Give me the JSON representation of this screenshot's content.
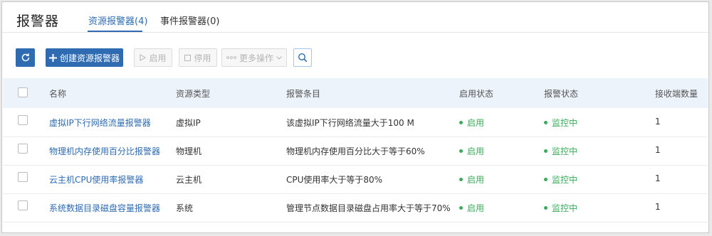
{
  "page": {
    "title": "报警器",
    "tabs": [
      {
        "label": "资源报警器(4)",
        "active": true
      },
      {
        "label": "事件报警器(0)",
        "active": false
      }
    ]
  },
  "toolbar": {
    "refresh_icon": "refresh-icon",
    "create_label": "创建资源报警器",
    "enable_label": "启用",
    "disable_label": "停用",
    "more_label": "更多操作",
    "search_icon": "search-icon"
  },
  "table": {
    "headers": [
      "名称",
      "资源类型",
      "报警条目",
      "启用状态",
      "报警状态",
      "接收端数量"
    ],
    "rows": [
      {
        "name": "虚拟IP下行网络流量报警器",
        "type": "虚拟IP",
        "condition": "该虚拟IP下行网络流量大于100 M",
        "enable": "启用",
        "alarm": "监控中",
        "receivers": "1"
      },
      {
        "name": "物理机内存使用百分比报警器",
        "type": "物理机",
        "condition": "物理机内存使用百分比大于等于60%",
        "enable": "启用",
        "alarm": "监控中",
        "receivers": "1"
      },
      {
        "name": "云主机CPU使用率报警器",
        "type": "云主机",
        "condition": "CPU使用率大于等于80%",
        "enable": "启用",
        "alarm": "监控中",
        "receivers": "1"
      },
      {
        "name": "系统数据目录磁盘容量报警器",
        "type": "系统",
        "condition": "管理节点数据目录磁盘占用率大于等于70%",
        "enable": "启用",
        "alarm": "监控中",
        "receivers": "1"
      }
    ]
  },
  "colors": {
    "accent": "#2e6bb0",
    "status_green": "#3aaa5b",
    "header_bg": "#edf3fa"
  }
}
